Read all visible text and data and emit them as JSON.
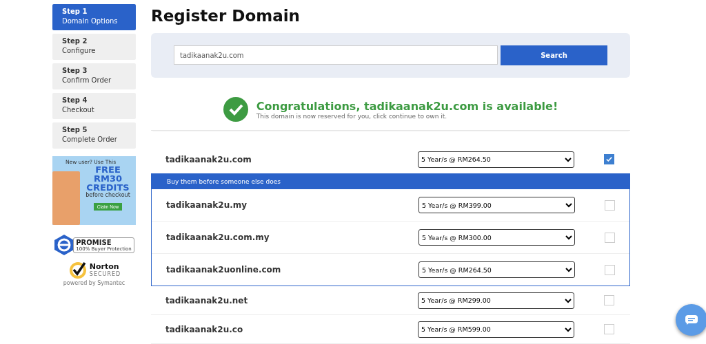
{
  "steps": [
    {
      "number": "Step 1",
      "label": "Domain Options",
      "selected": true
    },
    {
      "number": "Step 2",
      "label": "Configure",
      "selected": false
    },
    {
      "number": "Step 3",
      "label": "Confirm Order",
      "selected": false
    },
    {
      "number": "Step 4",
      "label": "Checkout",
      "selected": false
    },
    {
      "number": "Step 5",
      "label": "Complete Order",
      "selected": false
    }
  ],
  "promo": {
    "intro": "New user? Use This",
    "headline": [
      "FREE",
      "RM30",
      "CREDITS"
    ],
    "note": "before checkout",
    "button": "Claim Now"
  },
  "badges": {
    "promise": {
      "title": "PROMISE",
      "subtitle": "100% Buyer Protection"
    },
    "norton": {
      "title": "Norton",
      "subtitle": "SECURED",
      "powered": "powered by Symantec"
    }
  },
  "title": "Register Domain",
  "search": {
    "value": "tadikaanak2u.com",
    "button": "Search"
  },
  "result": {
    "headline": "Congratulations, tadikaanak2u.com is available!",
    "message": "This domain is now reserved for you, click continue to own it."
  },
  "main_domain": {
    "name": "tadikaanak2u.com",
    "price": "5 Year/s @ RM264.50",
    "checked": true
  },
  "suggestions": {
    "heading": "Buy them before someone else does",
    "items": [
      {
        "name": "tadikaanak2u.my",
        "price": "5 Year/s @ RM399.00",
        "checked": false
      },
      {
        "name": "tadikaanak2u.com.my",
        "price": "5 Year/s @ RM300.00",
        "checked": false
      },
      {
        "name": "tadikaanak2uonline.com",
        "price": "5 Year/s @ RM264.50",
        "checked": false
      }
    ]
  },
  "more_domains": [
    {
      "name": "tadikaanak2u.net",
      "price": "5 Year/s @ RM299.00",
      "checked": false
    },
    {
      "name": "tadikaanak2u.co",
      "price": "5 Year/s @ RM599.00",
      "checked": false
    }
  ]
}
